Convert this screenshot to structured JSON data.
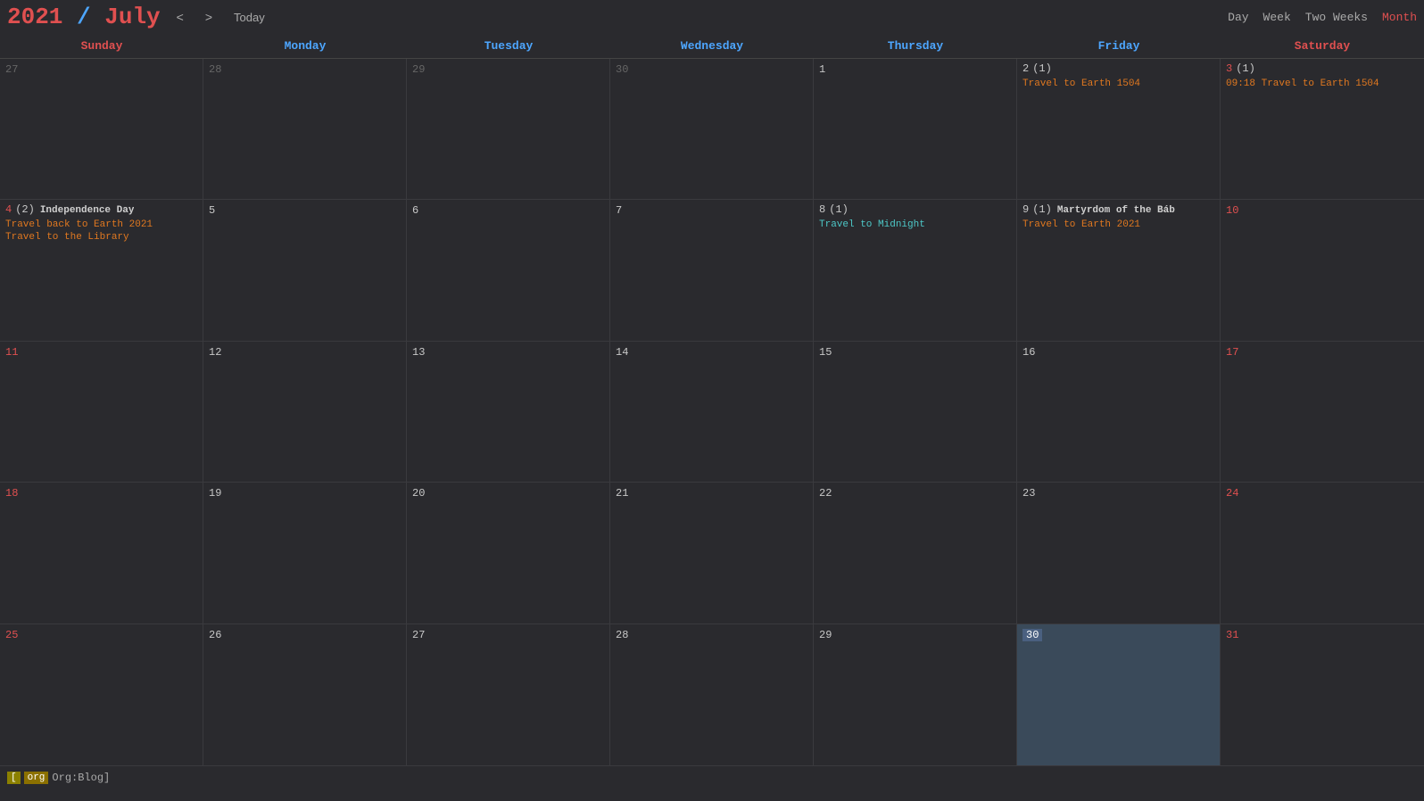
{
  "header": {
    "title_year": "2021",
    "title_separator": " / ",
    "title_month": "July",
    "nav_prev": "<",
    "nav_next": ">",
    "today_label": "Today",
    "views": [
      {
        "label": "Day",
        "active": false
      },
      {
        "label": "Week",
        "active": false
      },
      {
        "label": "Two Weeks",
        "active": false
      },
      {
        "label": "Month",
        "active": true
      }
    ]
  },
  "day_headers": [
    {
      "label": "Sunday",
      "type": "weekend"
    },
    {
      "label": "Monday",
      "type": "weekday"
    },
    {
      "label": "Tuesday",
      "type": "weekday"
    },
    {
      "label": "Wednesday",
      "type": "weekday"
    },
    {
      "label": "Thursday",
      "type": "weekday"
    },
    {
      "label": "Friday",
      "type": "weekday"
    },
    {
      "label": "Saturday",
      "type": "weekend"
    }
  ],
  "weeks": [
    {
      "days": [
        {
          "num": "27",
          "out_of_month": true,
          "weekend": true,
          "events": []
        },
        {
          "num": "28",
          "out_of_month": true,
          "events": []
        },
        {
          "num": "29",
          "out_of_month": true,
          "events": []
        },
        {
          "num": "30",
          "out_of_month": true,
          "events": []
        },
        {
          "num": "1",
          "events": []
        },
        {
          "num": "2",
          "count": "(1)",
          "events": [
            {
              "text": "Travel to Earth 1504",
              "style": "orange"
            }
          ]
        },
        {
          "num": "3",
          "count": "(1)",
          "weekend": true,
          "events": [
            {
              "text": "09:18 Travel to Earth 1504",
              "style": "orange"
            }
          ]
        }
      ]
    },
    {
      "days": [
        {
          "num": "4",
          "count": "(2)",
          "weekend": true,
          "events": [
            {
              "text": "Independence Day",
              "style": "white",
              "bold": true
            },
            {
              "text": "Travel back to Earth 2021",
              "style": "orange"
            },
            {
              "text": "Travel to the Library",
              "style": "orange"
            }
          ]
        },
        {
          "num": "5",
          "events": []
        },
        {
          "num": "6",
          "events": []
        },
        {
          "num": "7",
          "events": []
        },
        {
          "num": "8",
          "count": "(1)",
          "events": [
            {
              "text": "Travel to Midnight",
              "style": "cyan"
            }
          ]
        },
        {
          "num": "9",
          "count": "(1)",
          "events": [
            {
              "text": "Martyrdom of the Báb",
              "style": "white",
              "bold": true
            },
            {
              "text": "Travel to Earth 2021",
              "style": "orange"
            }
          ]
        },
        {
          "num": "10",
          "weekend": true,
          "events": []
        }
      ]
    },
    {
      "days": [
        {
          "num": "11",
          "weekend": true,
          "events": []
        },
        {
          "num": "12",
          "events": []
        },
        {
          "num": "13",
          "events": []
        },
        {
          "num": "14",
          "events": []
        },
        {
          "num": "15",
          "events": []
        },
        {
          "num": "16",
          "events": []
        },
        {
          "num": "17",
          "weekend": true,
          "events": []
        }
      ]
    },
    {
      "days": [
        {
          "num": "18",
          "weekend": true,
          "events": []
        },
        {
          "num": "19",
          "events": []
        },
        {
          "num": "20",
          "events": []
        },
        {
          "num": "21",
          "events": []
        },
        {
          "num": "22",
          "events": []
        },
        {
          "num": "23",
          "events": []
        },
        {
          "num": "24",
          "weekend": true,
          "events": []
        }
      ]
    },
    {
      "days": [
        {
          "num": "25",
          "weekend": true,
          "events": []
        },
        {
          "num": "26",
          "events": []
        },
        {
          "num": "27",
          "events": []
        },
        {
          "num": "28",
          "events": []
        },
        {
          "num": "29",
          "events": []
        },
        {
          "num": "30",
          "today": true,
          "events": []
        },
        {
          "num": "31",
          "weekend": true,
          "events": []
        }
      ]
    }
  ],
  "footer": {
    "tag_label": "org",
    "text": "Org:Blog]"
  }
}
